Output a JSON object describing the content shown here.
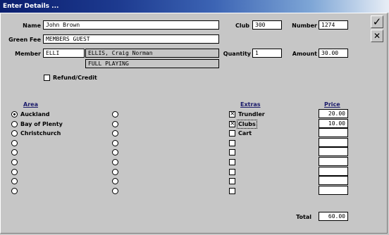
{
  "window": {
    "title": "Enter Details ..."
  },
  "toolbar": {
    "ok_icon": "✓",
    "cancel_icon": "✕"
  },
  "fields": {
    "name": {
      "label": "Name",
      "value": "John Brown"
    },
    "green_fee": {
      "label": "Green Fee",
      "value": "MEMBERS GUEST"
    },
    "member": {
      "label": "Member",
      "code": "ELLI",
      "name": "ELLIS, Craig Norman",
      "status": "FULL PLAYING"
    },
    "club": {
      "label": "Club",
      "value": "300"
    },
    "number": {
      "label": "Number",
      "value": "1274"
    },
    "quantity": {
      "label": "Quantity",
      "value": "1"
    },
    "amount": {
      "label": "Amount",
      "value": "30.00"
    },
    "refund": {
      "label": "Refund/Credit",
      "checked": false
    }
  },
  "area": {
    "header": "Area",
    "options": [
      "Auckland",
      "Bay of Plenty",
      "Christchurch",
      "",
      "",
      "",
      "",
      "",
      ""
    ],
    "selected": 0
  },
  "extras": {
    "header": "Extras",
    "price_header": "Price",
    "items": [
      {
        "label": "Trundler",
        "checked": true,
        "price": "20.00"
      },
      {
        "label": "Clubs",
        "checked": true,
        "price": "10.00",
        "focused": true
      },
      {
        "label": "Cart",
        "checked": false,
        "price": ""
      },
      {
        "label": "",
        "checked": false,
        "price": ""
      },
      {
        "label": "",
        "checked": false,
        "price": ""
      },
      {
        "label": "",
        "checked": false,
        "price": ""
      },
      {
        "label": "",
        "checked": false,
        "price": ""
      },
      {
        "label": "",
        "checked": false,
        "price": ""
      },
      {
        "label": "",
        "checked": false,
        "price": ""
      }
    ]
  },
  "total": {
    "label": "Total",
    "value": "60.00"
  }
}
